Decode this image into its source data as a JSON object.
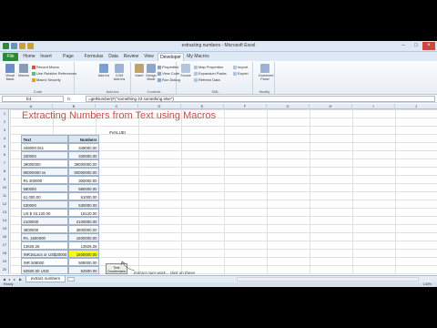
{
  "window": {
    "title": "extracting numbers - Microsoft Excel"
  },
  "tabs": [
    "File",
    "Home",
    "Insert",
    "Page Layout",
    "Formulas",
    "Data",
    "Review",
    "View",
    "Developer",
    "My Macros"
  ],
  "active_tab": "Developer",
  "ribbon": {
    "code": {
      "label": "Code",
      "visual_basic": "Visual Basic",
      "macros": "Macros",
      "record": "Record Macro",
      "relative": "Use Relative References",
      "security": "Macro Security"
    },
    "addins": {
      "label": "Add-Ins",
      "addins": "Add-Ins",
      "com": "COM Add-Ins"
    },
    "controls": {
      "label": "Controls",
      "insert": "Insert",
      "design": "Design Mode",
      "properties": "Properties",
      "view_code": "View Code",
      "run_dialog": "Run Dialog"
    },
    "xml": {
      "label": "XML",
      "source": "Source",
      "map_props": "Map Properties",
      "expansion": "Expansion Packs",
      "refresh": "Refresh Data",
      "import": "Import",
      "export": "Export"
    },
    "modify": {
      "label": "Modify",
      "doc_panel": "Document Panel"
    }
  },
  "formula_bar": {
    "name_box": "E4",
    "fx": "fx",
    "formula": "=getNumber(F(\"something 23 something else\")"
  },
  "heading": "Extracting Numbers from Text using Macros",
  "error_value": "#VALUE!",
  "table": {
    "headers": [
      "Text",
      "Numbers"
    ],
    "rows": [
      [
        "349000.0ss",
        "349000.00"
      ],
      [
        "330000",
        "330000.00"
      ],
      [
        "39000000",
        "39000000.00"
      ],
      [
        "90000000 ss",
        "90000000.00"
      ],
      [
        "Rs 300000",
        "300000.00"
      ],
      [
        "580000",
        "580000.00"
      ],
      [
        "61,000.00",
        "61000.00"
      ],
      [
        "530000",
        "530000.00"
      ],
      [
        "US $ 15,120.00",
        "15120.00"
      ],
      [
        "2100000",
        "2100000.00"
      ],
      [
        "3800000",
        "3800000.00"
      ],
      [
        "Rs. 1500000",
        "1500000.00"
      ],
      [
        "13626.26",
        "13626.26"
      ],
      [
        "INR16Lacs or US$20000",
        "1600000.00"
      ],
      [
        "INR 508000",
        "508000.00"
      ],
      [
        "52500.00 USD",
        "52500.00"
      ]
    ]
  },
  "buttons": {
    "test": "Test\nDoubledata",
    "run": "Run\nFunctions!"
  },
  "annotation": "Extract num work... click on these",
  "sheet_tab": "extract numbers",
  "status": "Ready",
  "zoom": "140%"
}
